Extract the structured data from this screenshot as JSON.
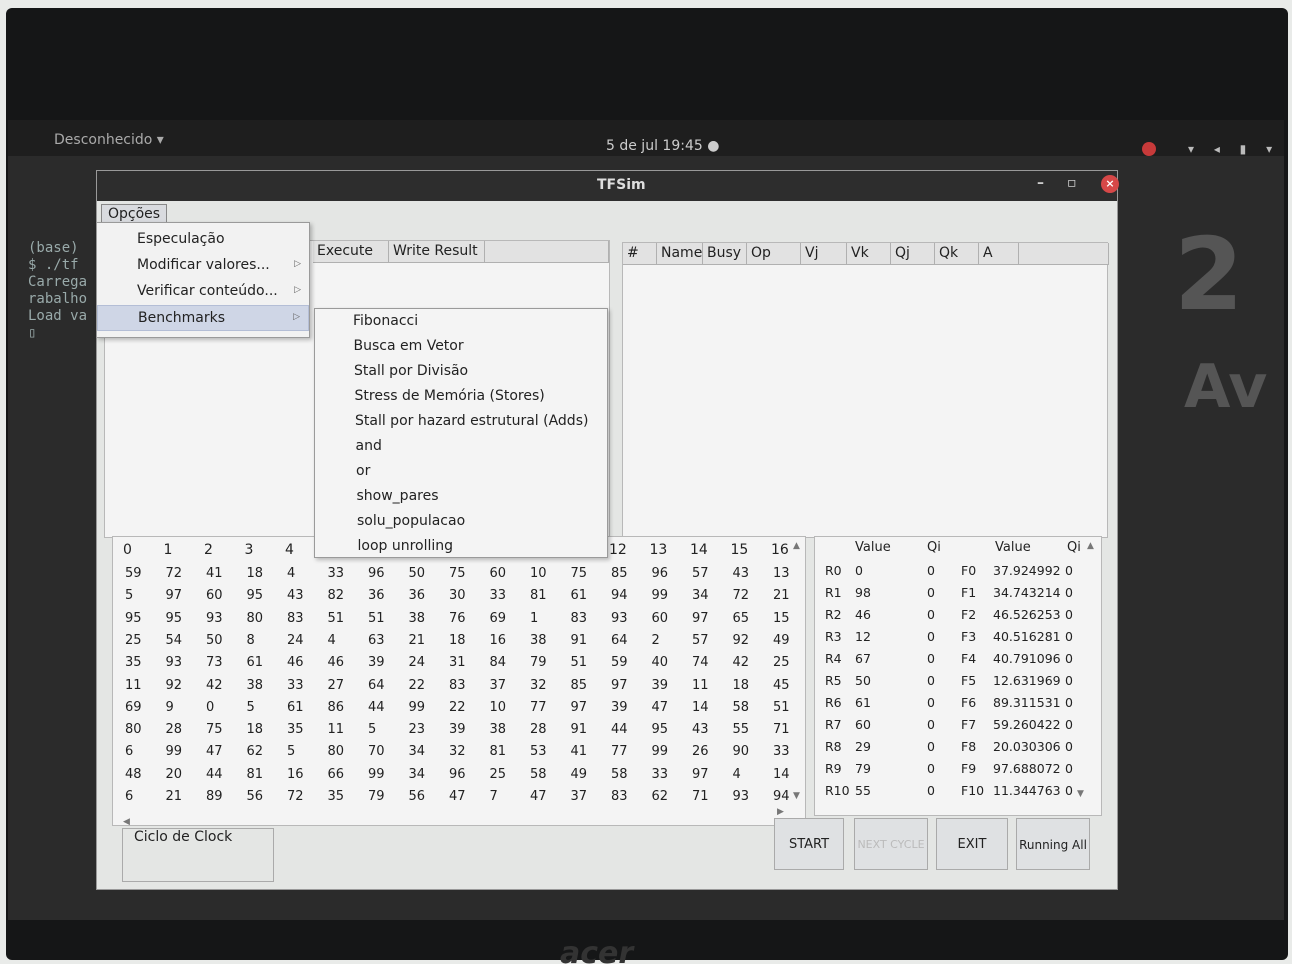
{
  "desktop": {
    "activities": "Desconhecido ▾",
    "clock": "5 de jul  19:45  ●",
    "tray": "▾ ◂ ▮ ▾",
    "terminal_lines": [
      "(base)",
      "$ ./tf",
      "",
      "",
      "",
      "Carrega",
      "rabalho",
      "Load va",
      "▯"
    ],
    "right_big": "2",
    "right_av": "Av",
    "logo": "acer"
  },
  "window": {
    "title": "TFSim",
    "minimize": "–",
    "maximize": "▫",
    "close": "×"
  },
  "menu": {
    "opcoes": "Opções",
    "items": [
      {
        "label": "Especulação",
        "arrow": ""
      },
      {
        "label": "Modificar valores...",
        "arrow": "▷"
      },
      {
        "label": "Verificar conteúdo...",
        "arrow": "▷"
      },
      {
        "label": "Benchmarks",
        "arrow": "▷"
      }
    ],
    "benchmarks": [
      "Fibonacci",
      "Busca em Vetor",
      "Stall por Divisão",
      "Stress de Memória (Stores)",
      "Stall por hazard estrutural (Adds)",
      "and",
      "or",
      "show_pares",
      "solu_populacao",
      "loop unrolling"
    ]
  },
  "instr_table": {
    "headers": [
      "Execute",
      "Write Result"
    ]
  },
  "rs_table": {
    "headers": [
      "#",
      "Name",
      "Busy",
      "Op",
      "Vj",
      "Vk",
      "Qj",
      "Qk",
      "A"
    ]
  },
  "memory": {
    "headers": [
      "0",
      "1",
      "2",
      "3",
      "4",
      "",
      "",
      "",
      "",
      "",
      "",
      "",
      "12",
      "13",
      "14",
      "15",
      "16"
    ],
    "rows": [
      [
        "59",
        "72",
        "41",
        "18",
        "4",
        "33",
        "96",
        "50",
        "75",
        "60",
        "10",
        "75",
        "85",
        "96",
        "57",
        "43",
        "13"
      ],
      [
        "5",
        "97",
        "60",
        "95",
        "43",
        "82",
        "36",
        "36",
        "30",
        "33",
        "81",
        "61",
        "94",
        "99",
        "34",
        "72",
        "21"
      ],
      [
        "95",
        "95",
        "93",
        "80",
        "83",
        "51",
        "51",
        "38",
        "76",
        "69",
        "1",
        "83",
        "93",
        "60",
        "97",
        "65",
        "15"
      ],
      [
        "25",
        "54",
        "50",
        "8",
        "24",
        "4",
        "63",
        "21",
        "18",
        "16",
        "38",
        "91",
        "64",
        "2",
        "57",
        "92",
        "49"
      ],
      [
        "35",
        "93",
        "73",
        "61",
        "46",
        "46",
        "39",
        "24",
        "31",
        "84",
        "79",
        "51",
        "59",
        "40",
        "74",
        "42",
        "25"
      ],
      [
        "11",
        "92",
        "42",
        "38",
        "33",
        "27",
        "64",
        "22",
        "83",
        "37",
        "32",
        "85",
        "97",
        "39",
        "11",
        "18",
        "45"
      ],
      [
        "69",
        "9",
        "0",
        "5",
        "61",
        "86",
        "44",
        "99",
        "22",
        "10",
        "77",
        "97",
        "39",
        "47",
        "14",
        "58",
        "51"
      ],
      [
        "80",
        "28",
        "75",
        "18",
        "35",
        "11",
        "5",
        "23",
        "39",
        "38",
        "28",
        "91",
        "44",
        "95",
        "43",
        "55",
        "71"
      ],
      [
        "6",
        "99",
        "47",
        "62",
        "5",
        "80",
        "70",
        "34",
        "32",
        "81",
        "53",
        "41",
        "77",
        "99",
        "26",
        "90",
        "33"
      ],
      [
        "48",
        "20",
        "44",
        "81",
        "16",
        "66",
        "99",
        "34",
        "96",
        "25",
        "58",
        "49",
        "58",
        "33",
        "97",
        "4",
        "14"
      ],
      [
        "6",
        "21",
        "89",
        "56",
        "72",
        "35",
        "79",
        "56",
        "47",
        "7",
        "47",
        "37",
        "83",
        "62",
        "71",
        "93",
        "94"
      ]
    ]
  },
  "registers": {
    "headers": [
      "Value",
      "Qi",
      "Value",
      "Qi"
    ],
    "rows": [
      [
        "R0",
        "0",
        "0",
        "F0",
        "37.924992",
        "0"
      ],
      [
        "R1",
        "98",
        "0",
        "F1",
        "34.743214",
        "0"
      ],
      [
        "R2",
        "46",
        "0",
        "F2",
        "46.526253",
        "0"
      ],
      [
        "R3",
        "12",
        "0",
        "F3",
        "40.516281",
        "0"
      ],
      [
        "R4",
        "67",
        "0",
        "F4",
        "40.791096",
        "0"
      ],
      [
        "R5",
        "50",
        "0",
        "F5",
        "12.631969",
        "0"
      ],
      [
        "R6",
        "61",
        "0",
        "F6",
        "89.311531",
        "0"
      ],
      [
        "R7",
        "60",
        "0",
        "F7",
        "59.260422",
        "0"
      ],
      [
        "R8",
        "29",
        "0",
        "F8",
        "20.030306",
        "0"
      ],
      [
        "R9",
        "79",
        "0",
        "F9",
        "97.688072",
        "0"
      ],
      [
        "R10",
        "55",
        "0",
        "F10",
        "11.344763",
        "0"
      ]
    ]
  },
  "controls": {
    "clock_label": "Ciclo de Clock",
    "start": "START",
    "next": "NEXT CYCLE",
    "exit": "EXIT",
    "run_all": "Running All"
  }
}
